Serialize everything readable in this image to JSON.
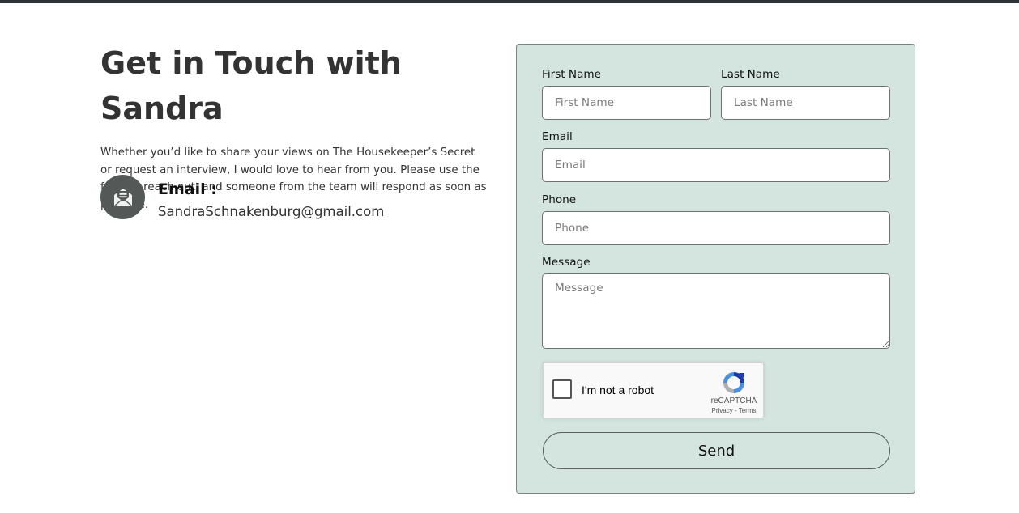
{
  "heading": "Get in Touch with Sandra",
  "intro": "Whether you’d like to share your views on The Housekeeper’s Secret or request an interview, I would love to hear from you. Please use the form to reach out, and someone from the team will respond as soon as possible.",
  "contact": {
    "icon": "open-envelope-icon",
    "label": "Email :",
    "value": "SandraSchnakenburg@gmail.com"
  },
  "form": {
    "first_name": {
      "label": "First Name",
      "placeholder": "First Name",
      "value": ""
    },
    "last_name": {
      "label": "Last Name",
      "placeholder": "Last Name",
      "value": ""
    },
    "email": {
      "label": "Email",
      "placeholder": "Email",
      "value": ""
    },
    "phone": {
      "label": "Phone",
      "placeholder": "Phone",
      "value": ""
    },
    "message": {
      "label": "Message",
      "placeholder": "Message",
      "value": ""
    },
    "recaptcha": {
      "text": "I'm not a robot",
      "brand": "reCAPTCHA",
      "links": "Privacy - Terms",
      "checked": false
    },
    "submit_label": "Send"
  },
  "colors": {
    "topbar": "#2c3236",
    "panel_bg": "#d3e5de",
    "icon_bg": "#545958",
    "text": "#333333"
  }
}
